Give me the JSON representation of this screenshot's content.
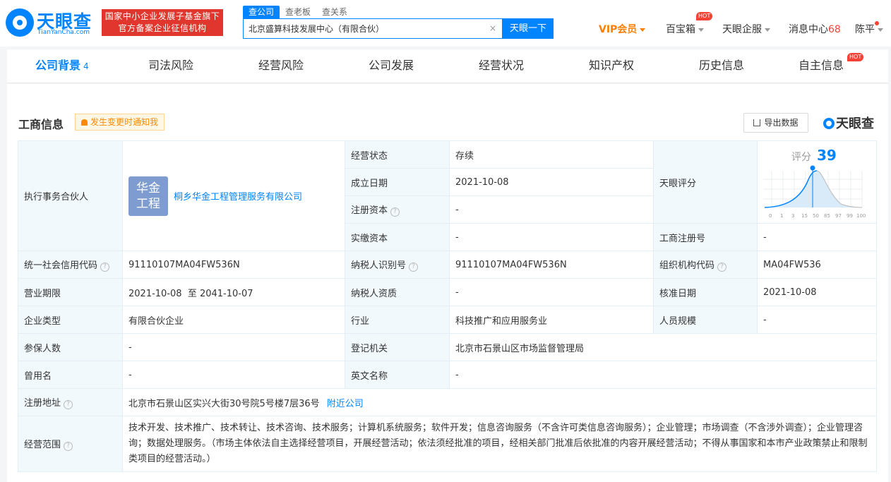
{
  "header": {
    "logo_cn": "天眼查",
    "logo_en": "TianYanCha.com",
    "banner_line1": "国家中小企业发展子基金旗下",
    "banner_line2": "官方备案企业征信机构",
    "search_tabs": [
      "查公司",
      "查老板",
      "查关系"
    ],
    "search_value": "北京盛算科技发展中心（有限合伙）",
    "search_clear": "×",
    "search_button": "天眼一下",
    "vip": "VIP会员",
    "baibao": "百宝箱",
    "hot": "HOT",
    "qifu": "天眼企服",
    "msg_label": "消息中心",
    "msg_count": "68",
    "user": "陈平"
  },
  "tabs": [
    {
      "label": "公司背景",
      "count": "4"
    },
    {
      "label": "司法风险"
    },
    {
      "label": "经营风险"
    },
    {
      "label": "公司发展"
    },
    {
      "label": "经营状况"
    },
    {
      "label": "知识产权"
    },
    {
      "label": "历史信息"
    },
    {
      "label": "自主信息",
      "hot": "HOT"
    }
  ],
  "section": {
    "title": "工商信息",
    "notify": "发生变更时通知我",
    "export": "导出数据",
    "brand": "天眼查"
  },
  "info": {
    "partner_label": "执行事务合伙人",
    "partner_avatar": "华金工程",
    "partner_avatar_l1": "华金",
    "partner_avatar_l2": "工程",
    "partner_name": "桐乡华金工程管理服务有限公司",
    "status_label": "经营状态",
    "status_value": "存续",
    "found_label": "成立日期",
    "found_value": "2021-10-08",
    "regcap_label": "注册资本",
    "regcap_value": "-",
    "paidcap_label": "实缴资本",
    "paidcap_value": "-",
    "score_label": "天眼评分",
    "score_title": "评分",
    "score_value": "39",
    "score_ticks": [
      "0",
      "1",
      "3",
      "15",
      "50",
      "85",
      "97",
      "99",
      "100"
    ],
    "regno_label": "工商注册号",
    "regno_value": "-",
    "credit_label": "统一社会信用代码",
    "credit_value": "91110107MA04FW536N",
    "taxid_label": "纳税人识别号",
    "taxid_value": "91110107MA04FW536N",
    "orgcode_label": "组织机构代码",
    "orgcode_value": "MA04FW536",
    "term_label": "营业期限",
    "term_value": "2021-10-08  至 2041-10-07",
    "taxqual_label": "纳税人资质",
    "taxqual_value": "-",
    "approve_label": "核准日期",
    "approve_value": "2021-10-08",
    "type_label": "企业类型",
    "type_value": "有限合伙企业",
    "industry_label": "行业",
    "industry_value": "科技推广和应用服务业",
    "staff_label": "人员规模",
    "staff_value": "-",
    "insured_label": "参保人数",
    "insured_value": "-",
    "authority_label": "登记机关",
    "authority_value": "北京市石景山区市场监督管理局",
    "formername_label": "曾用名",
    "formername_value": "-",
    "english_label": "英文名称",
    "english_value": "-",
    "address_label": "注册地址",
    "address_value": "北京市石景山区实兴大街30号院5号楼7层36号",
    "nearby": "附近公司",
    "scope_label": "经营范围",
    "scope_value": "技术开发、技术推广、技术转让、技术咨询、技术服务；计算机系统服务；软件开发；信息咨询服务（不含许可类信息咨询服务）；企业管理；市场调查（不含涉外调查）；企业管理咨询；数据处理服务。（市场主体依法自主选择经营项目，开展经营活动；依法须经批准的项目，经相关部门批准后依批准的内容开展经营活动；不得从事国家和本市产业政策禁止和限制类项目的经营活动。）",
    "help_icon": "?"
  }
}
